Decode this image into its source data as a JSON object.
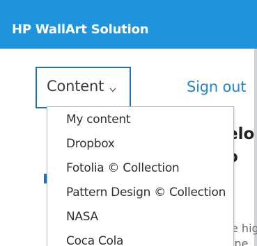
{
  "header": {
    "title": "HP WallArt Solution",
    "background_color": "#1f94dc"
  },
  "nav": {
    "content_button_label": "Content",
    "content_chevron_icon": "chevron-down-icon",
    "sign_out_label": "Sign out",
    "accent_color": "#1f86d4"
  },
  "dropdown": {
    "items": [
      {
        "label": "My content"
      },
      {
        "label": "Dropbox"
      },
      {
        "label": "Fotolia © Collection"
      },
      {
        "label": "Pattern Design © Collection"
      },
      {
        "label": "NASA"
      },
      {
        "label": "Coca Cola"
      }
    ]
  },
  "background": {
    "heading_fragment_1": "elo",
    "heading_fragment_2": "o",
    "paragraph_fragment_1": "e hig",
    "paragraph_fragment_2": "ine"
  }
}
